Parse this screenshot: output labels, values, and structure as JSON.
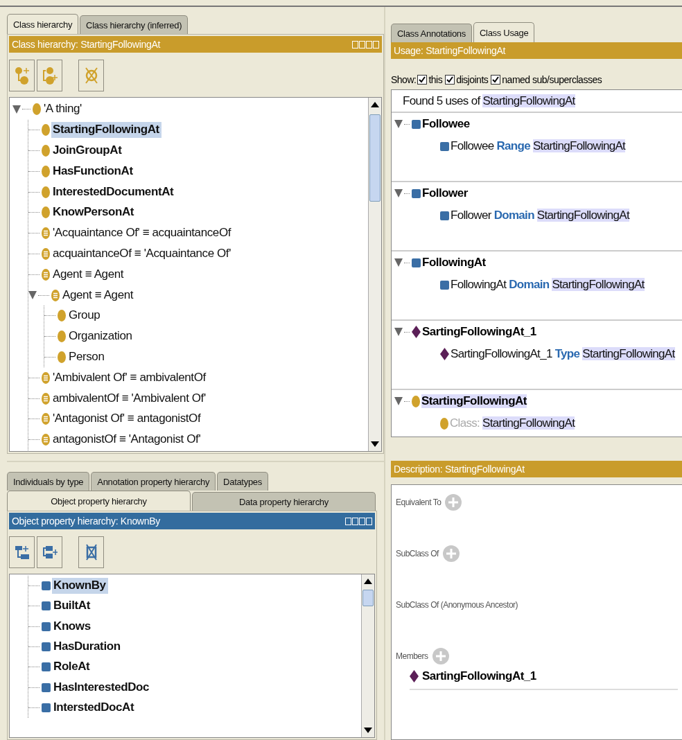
{
  "class_panel": {
    "kind": "class",
    "tabs": [
      {
        "label": "Class hierarchy",
        "selected": true
      },
      {
        "label": "Class hierarchy (inferred)",
        "selected": false
      }
    ],
    "title": "Class hierarchy: StartingFollowingAt",
    "tree": [
      {
        "label": "'A thing'",
        "kind": "class",
        "bold": false,
        "selected": false,
        "expanded": true,
        "children": [
          {
            "label": "StartingFollowingAt",
            "kind": "class",
            "bold": true,
            "selected": true
          },
          {
            "label": "JoinGroupAt",
            "kind": "class",
            "bold": true,
            "selected": false
          },
          {
            "label": "HasFunctionAt",
            "kind": "class",
            "bold": true,
            "selected": false
          },
          {
            "label": "InterestedDocumentAt",
            "kind": "class",
            "bold": true,
            "selected": false
          },
          {
            "label": "KnowPersonAt",
            "kind": "class",
            "bold": true,
            "selected": false
          },
          {
            "label": "'Acquaintance Of' ≡ acquaintanceOf",
            "kind": "defined",
            "bold": false,
            "selected": false
          },
          {
            "label": "acquaintanceOf ≡ 'Acquaintance Of'",
            "kind": "defined",
            "bold": false,
            "selected": false
          },
          {
            "label": "Agent ≡ Agent",
            "kind": "defined",
            "bold": false,
            "selected": false
          },
          {
            "label": "Agent ≡ Agent",
            "kind": "defined",
            "bold": false,
            "selected": false,
            "expanded": true,
            "children": [
              {
                "label": "Group",
                "kind": "class",
                "bold": false,
                "selected": false
              },
              {
                "label": "Organization",
                "kind": "class",
                "bold": false,
                "selected": false
              },
              {
                "label": "Person",
                "kind": "class",
                "bold": false,
                "selected": false
              }
            ]
          },
          {
            "label": "'Ambivalent Of' ≡ ambivalentOf",
            "kind": "defined",
            "bold": false,
            "selected": false
          },
          {
            "label": "ambivalentOf ≡ 'Ambivalent Of'",
            "kind": "defined",
            "bold": false,
            "selected": false
          },
          {
            "label": "'Antagonist Of' ≡ antagonistOf",
            "kind": "defined",
            "bold": false,
            "selected": false
          },
          {
            "label": "antagonistOf ≡ 'Antagonist Of'",
            "kind": "defined",
            "bold": false,
            "selected": false
          }
        ]
      }
    ]
  },
  "property_panel": {
    "kind": "property",
    "tab_rows": [
      {
        "tabs": [
          {
            "label": "Individuals by type",
            "selected": false
          },
          {
            "label": "Annotation property hierarchy",
            "selected": false
          },
          {
            "label": "Datatypes",
            "selected": false
          }
        ]
      },
      {
        "tabs": [
          {
            "label": "Object property hierarchy",
            "selected": true
          },
          {
            "label": "Data property hierarchy",
            "selected": false
          }
        ]
      }
    ],
    "title": "Object property hierarchy: KnownBy",
    "tree": [
      {
        "label": "KnownBy",
        "kind": "property",
        "bold": true,
        "selected": true
      },
      {
        "label": "BuiltAt",
        "kind": "property",
        "bold": true,
        "selected": false
      },
      {
        "label": "Knows",
        "kind": "property",
        "bold": true,
        "selected": false
      },
      {
        "label": "HasDuration",
        "kind": "property",
        "bold": true,
        "selected": false
      },
      {
        "label": "RoleAt",
        "kind": "property",
        "bold": true,
        "selected": false
      },
      {
        "label": "HasInterestedDoc",
        "kind": "property",
        "bold": true,
        "selected": false
      },
      {
        "label": "InterstedDocAt",
        "kind": "property",
        "bold": true,
        "selected": false
      }
    ]
  },
  "usage_panel": {
    "tabs": [
      {
        "label": "Class Annotations",
        "selected": false
      },
      {
        "label": "Class Usage",
        "selected": true
      }
    ],
    "title": "Usage: StartingFollowingAt",
    "show_label": "Show:",
    "options": [
      {
        "label": "this",
        "checked": true
      },
      {
        "label": "disjoints",
        "checked": true
      },
      {
        "label": "named sub/superclasses",
        "checked": true
      }
    ],
    "summary": {
      "text": "Found 5 uses of",
      "object": "StartingFollowingAt"
    },
    "groups": [
      {
        "label": "Followee",
        "kind": "property",
        "highlighted": false,
        "expanded": true,
        "entries": [
          {
            "kind": "property",
            "subject": "Followee",
            "keyword": "Range",
            "object": "StartingFollowingAt"
          }
        ]
      },
      {
        "label": "Follower",
        "kind": "property",
        "highlighted": false,
        "expanded": true,
        "entries": [
          {
            "kind": "property",
            "subject": "Follower",
            "keyword": "Domain",
            "object": "StartingFollowingAt"
          }
        ]
      },
      {
        "label": "FollowingAt",
        "kind": "property",
        "highlighted": false,
        "expanded": true,
        "entries": [
          {
            "kind": "property",
            "subject": "FollowingAt",
            "keyword": "Domain",
            "object": "StartingFollowingAt"
          }
        ]
      },
      {
        "label": "SartingFollowingAt_1",
        "kind": "individual",
        "highlighted": false,
        "expanded": true,
        "entries": [
          {
            "kind": "individual",
            "subject": "SartingFollowingAt_1",
            "keyword": "Type",
            "object": "StartingFollowingAt"
          }
        ]
      },
      {
        "label": "StartingFollowingAt",
        "kind": "class",
        "highlighted": true,
        "expanded": true,
        "entries": [
          {
            "kind": "class",
            "label": "Class:",
            "object": "StartingFollowingAt"
          }
        ]
      }
    ]
  },
  "description_panel": {
    "title": "Description: StartingFollowingAt",
    "sections": [
      {
        "label": "Equivalent To",
        "addable": true
      },
      {
        "label": "SubClass Of",
        "addable": true
      },
      {
        "label": "SubClass Of (Anonymous Ancestor)",
        "addable": false
      },
      {
        "label": "Members",
        "addable": true,
        "items": [
          {
            "label": "SartingFollowingAt_1",
            "kind": "individual"
          }
        ]
      }
    ]
  }
}
